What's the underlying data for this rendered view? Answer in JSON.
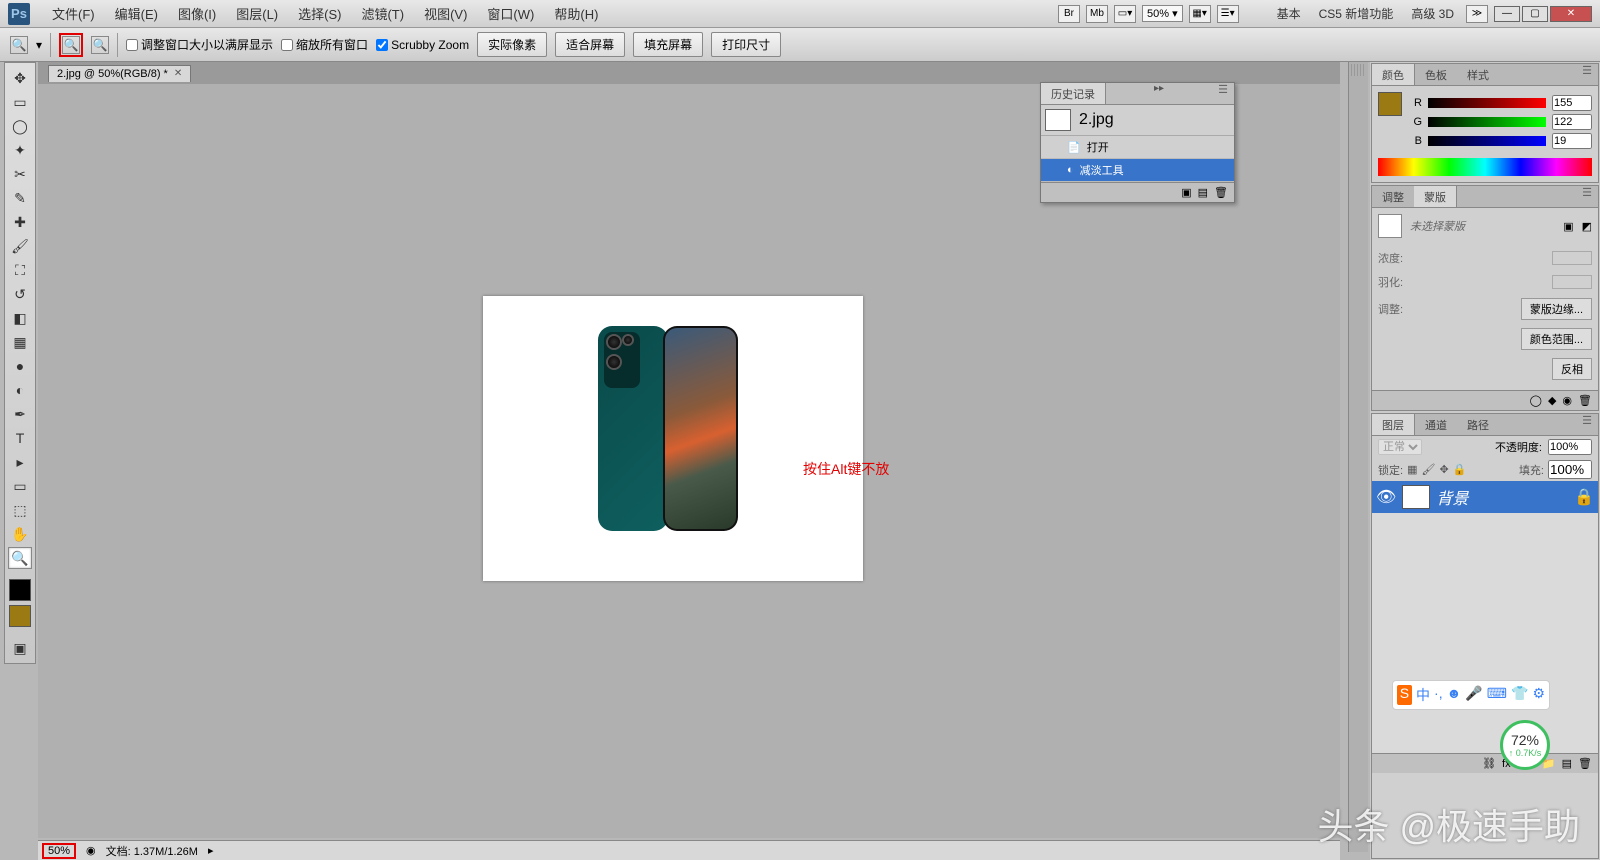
{
  "app": {
    "logo": "Ps"
  },
  "menu": {
    "file": "文件(F)",
    "edit": "编辑(E)",
    "image": "图像(I)",
    "layer": "图层(L)",
    "select": "选择(S)",
    "filter": "滤镜(T)",
    "view": "视图(V)",
    "window": "窗口(W)",
    "help": "帮助(H)"
  },
  "topbar": {
    "zoom_value": "50%",
    "workspace_basic": "基本",
    "workspace_cs5": "CS5 新增功能",
    "workspace_3d": "高级 3D"
  },
  "options": {
    "resize_fit": "调整窗口大小以满屏显示",
    "zoom_all": "缩放所有窗口",
    "scrubby": "Scrubby Zoom",
    "actual": "实际像素",
    "fit": "适合屏幕",
    "fill": "填充屏幕",
    "print": "打印尺寸"
  },
  "doc": {
    "tab": "2.jpg @ 50%(RGB/8) *",
    "annotation": "按住Alt键不放"
  },
  "history": {
    "title": "历史记录",
    "file": "2.jpg",
    "open": "打开",
    "dodge": "减淡工具"
  },
  "color": {
    "tab_color": "颜色",
    "tab_swatch": "色板",
    "tab_style": "样式",
    "r_label": "R",
    "r": "155",
    "g_label": "G",
    "g": "122",
    "b_label": "B",
    "b": "19"
  },
  "mask": {
    "tab_adjust": "调整",
    "tab_mask": "蒙版",
    "no_mask": "未选择蒙版",
    "density": "浓度:",
    "feather": "羽化:",
    "refine": "调整:",
    "mask_edge": "蒙版边缘...",
    "color_range": "颜色范围...",
    "invert": "反相"
  },
  "layers": {
    "tab_layers": "图层",
    "tab_channels": "通道",
    "tab_paths": "路径",
    "blend": "正常",
    "opacity_label": "不透明度:",
    "opacity": "100%",
    "lock_label": "锁定:",
    "fill_label": "填充:",
    "fill": "100%",
    "bg_layer": "背景"
  },
  "status": {
    "zoom": "50%",
    "doc_size": "文档: 1.37M/1.26M"
  },
  "battery": {
    "pct": "72%",
    "speed": "↑ 0.7K/s"
  },
  "watermark": "头条 @极速手助"
}
